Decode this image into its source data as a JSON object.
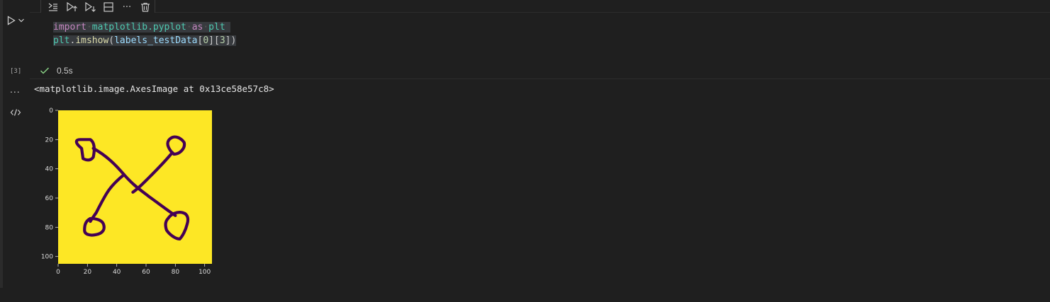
{
  "toolbar": {
    "items": [
      {
        "name": "run-by-line-icon"
      },
      {
        "name": "execute-above-icon"
      },
      {
        "name": "execute-below-icon"
      },
      {
        "name": "split-cell-icon"
      },
      {
        "name": "more-icon",
        "label": "···"
      },
      {
        "name": "delete-icon"
      }
    ]
  },
  "cell": {
    "code": {
      "line1": {
        "kw_import": "import",
        "module": "matplotlib.pyplot",
        "kw_as": "as",
        "alias": "plt"
      },
      "line2": {
        "obj": "plt",
        "dot": ".",
        "fn": "imshow",
        "open": "(",
        "arg": "labels_testData",
        "idx1_open": "[",
        "idx1": "0",
        "idx1_close": "]",
        "idx2_open": "[",
        "idx2": "3",
        "idx2_close": "]",
        "close": ")"
      }
    },
    "execution_count": "[3]",
    "status": {
      "icon": "check-icon",
      "time": "0.5s"
    }
  },
  "output": {
    "more_label": "...",
    "text": "<matplotlib.image.AxesImage at 0x13ce58e57c8>"
  },
  "chart_data": {
    "type": "image",
    "xticks": [
      "0",
      "20",
      "40",
      "60",
      "80",
      "100"
    ],
    "yticks": [
      "0",
      "20",
      "40",
      "60",
      "80",
      "100"
    ],
    "xlim": [
      0,
      105
    ],
    "ylim": [
      105,
      0
    ],
    "background_color": "#fde725",
    "stroke_color": "#440154"
  },
  "colors": {
    "background": "#1f1f1f",
    "check": "#89d185",
    "keyword": "#c586c0",
    "module": "#4ec9b0",
    "function": "#dcdcaa",
    "variable": "#9cdcfe",
    "number": "#b5cea8"
  }
}
